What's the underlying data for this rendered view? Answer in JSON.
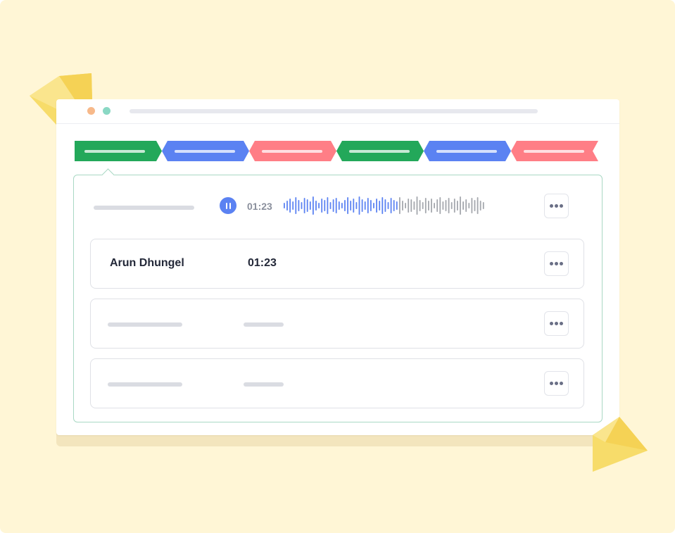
{
  "player": {
    "time": "01:23"
  },
  "recordings": [
    {
      "name": "Arun Dhungel",
      "duration": "01:23"
    }
  ],
  "colors": {
    "background": "#fff6d6",
    "green": "#23a85a",
    "blue": "#5b82f2",
    "red": "#ff7e86",
    "panel_border": "#a9d8c4",
    "wave_played": "#5b82f2",
    "wave_unplayed": "#a4a7ad",
    "gem": "#f7d964"
  },
  "segments": [
    {
      "color": "green",
      "active": true
    },
    {
      "color": "blue"
    },
    {
      "color": "red"
    },
    {
      "color": "green"
    },
    {
      "color": "blue"
    },
    {
      "color": "red"
    }
  ],
  "icons": [
    "pause-icon",
    "more-horizontal-icon"
  ]
}
